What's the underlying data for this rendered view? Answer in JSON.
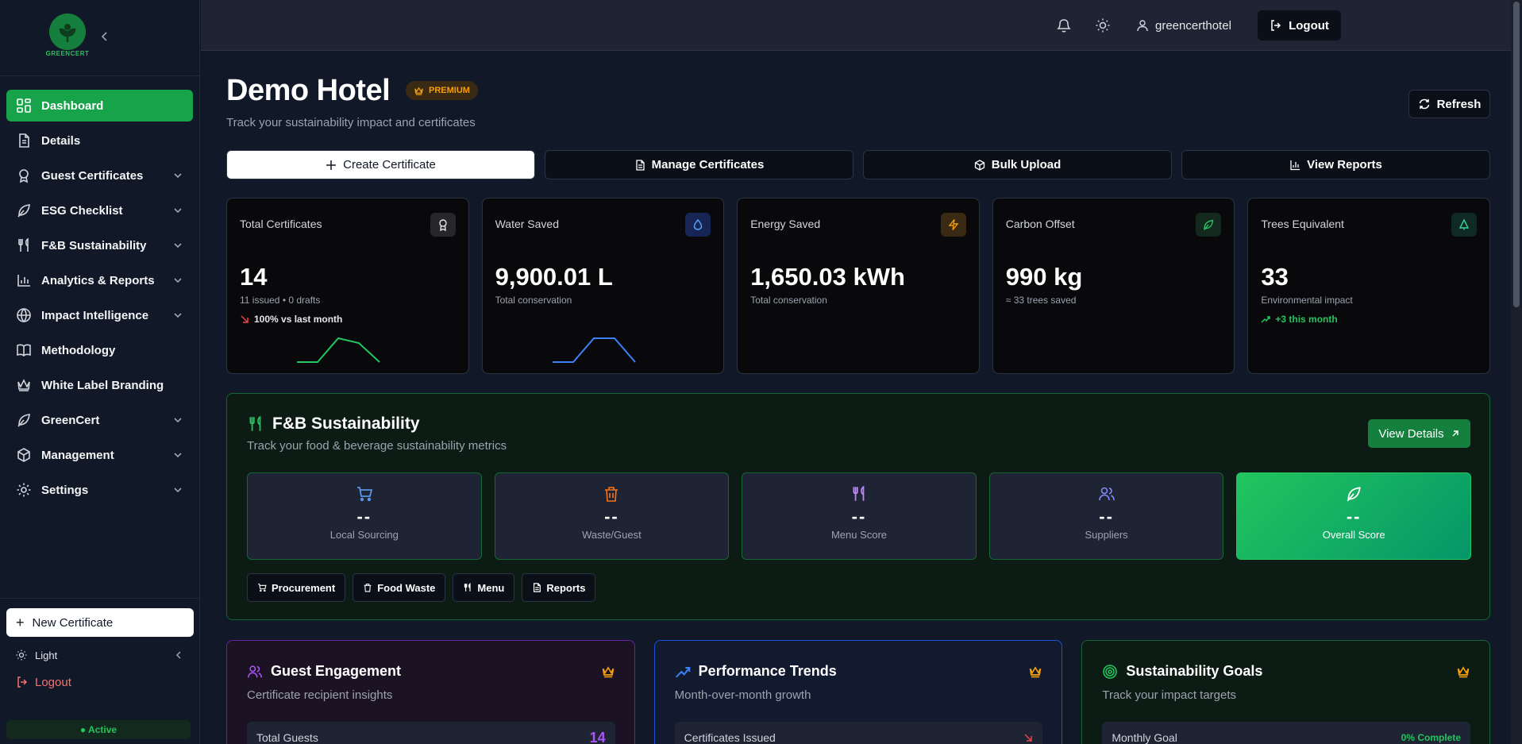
{
  "sidebar": {
    "logo_text": "GREENCERT",
    "items": [
      {
        "label": "Dashboard",
        "icon": "dashboard-icon",
        "active": true,
        "expandable": false
      },
      {
        "label": "Details",
        "icon": "document-icon",
        "active": false,
        "expandable": false
      },
      {
        "label": "Guest Certificates",
        "icon": "award-icon",
        "active": false,
        "expandable": true
      },
      {
        "label": "ESG Checklist",
        "icon": "leaf-icon",
        "active": false,
        "expandable": true
      },
      {
        "label": "F&B Sustainability",
        "icon": "utensils-icon",
        "active": false,
        "expandable": true
      },
      {
        "label": "Analytics & Reports",
        "icon": "bar-chart-icon",
        "active": false,
        "expandable": true
      },
      {
        "label": "Impact Intelligence",
        "icon": "globe-icon",
        "active": false,
        "expandable": true
      },
      {
        "label": "Methodology",
        "icon": "book-icon",
        "active": false,
        "expandable": false
      },
      {
        "label": "White Label Branding",
        "icon": "crown-icon",
        "active": false,
        "expandable": false
      },
      {
        "label": "GreenCert",
        "icon": "leaf-icon",
        "active": false,
        "expandable": true
      },
      {
        "label": "Management",
        "icon": "box-icon",
        "active": false,
        "expandable": true
      },
      {
        "label": "Settings",
        "icon": "gear-icon",
        "active": false,
        "expandable": true
      }
    ],
    "new_certificate": "New Certificate",
    "theme_label": "Light",
    "logout": "Logout",
    "status": "● Active"
  },
  "topbar": {
    "username": "greencerthotel",
    "logout": "Logout"
  },
  "header": {
    "title": "Demo Hotel",
    "badge": "PREMIUM",
    "subtitle": "Track your sustainability impact and certificates",
    "refresh": "Refresh"
  },
  "actions": {
    "create": "Create Certificate",
    "manage": "Manage Certificates",
    "bulk": "Bulk Upload",
    "reports": "View Reports"
  },
  "stats": [
    {
      "label": "Total Certificates",
      "value": "14",
      "sub": "11 issued • 0 drafts",
      "trend": "100% vs last month",
      "trend_dir": "down",
      "icon": "award-icon",
      "spark": [
        0,
        0,
        2,
        1.6,
        0
      ],
      "color": "#22c55e"
    },
    {
      "label": "Water Saved",
      "value": "9,900.01 L",
      "sub": "Total conservation",
      "trend": "",
      "icon": "droplet-icon",
      "spark": [
        0,
        0,
        2,
        2,
        0
      ],
      "color": "#3b82f6"
    },
    {
      "label": "Energy Saved",
      "value": "1,650.03 kWh",
      "sub": "Total conservation",
      "trend": "",
      "icon": "zap-icon"
    },
    {
      "label": "Carbon Offset",
      "value": "990 kg",
      "sub": "≈ 33 trees saved",
      "trend": "",
      "icon": "leaf-icon"
    },
    {
      "label": "Trees Equivalent",
      "value": "33",
      "sub": "Environmental impact",
      "trend": "+3 this month",
      "trend_dir": "up",
      "icon": "tree-icon"
    }
  ],
  "fb": {
    "title": "F&B Sustainability",
    "subtitle": "Track your food & beverage sustainability metrics",
    "view_details": "View Details",
    "metrics": [
      {
        "label": "Local Sourcing",
        "value": "--",
        "icon": "cart-icon",
        "color": "#60a5fa"
      },
      {
        "label": "Waste/Guest",
        "value": "--",
        "icon": "trash-icon",
        "color": "#f97316"
      },
      {
        "label": "Menu Score",
        "value": "--",
        "icon": "utensils-icon",
        "color": "#c084fc"
      },
      {
        "label": "Suppliers",
        "value": "--",
        "icon": "users-icon",
        "color": "#818cf8"
      },
      {
        "label": "Overall Score",
        "value": "--",
        "icon": "leaf-icon",
        "color": "#ffffff"
      }
    ],
    "tabs": [
      "Procurement",
      "Food Waste",
      "Menu",
      "Reports"
    ]
  },
  "panels": [
    {
      "title": "Guest Engagement",
      "subtitle": "Certificate recipient insights",
      "row_label": "Total Guests",
      "row_value": "14"
    },
    {
      "title": "Performance Trends",
      "subtitle": "Month-over-month growth",
      "row_label": "Certificates Issued",
      "row_value": ""
    },
    {
      "title": "Sustainability Goals",
      "subtitle": "Track your impact targets",
      "row_label": "Monthly Goal",
      "row_value": "0% Complete"
    }
  ]
}
